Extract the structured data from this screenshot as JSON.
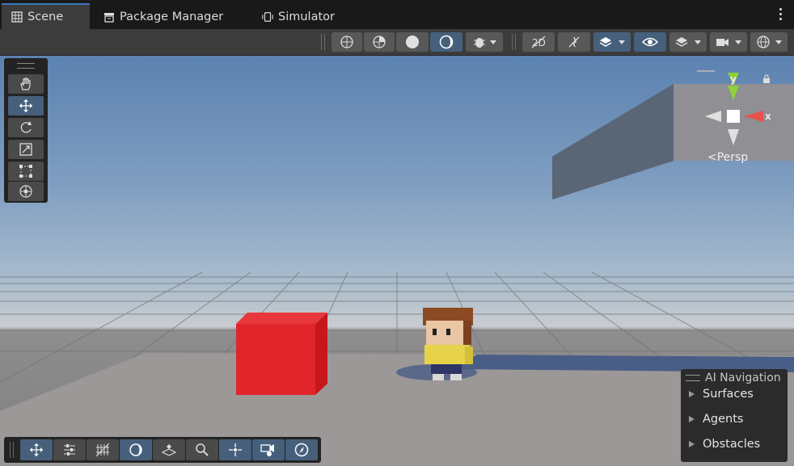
{
  "tabs": [
    {
      "label": "Scene",
      "icon": "scene-grid-icon",
      "active": true
    },
    {
      "label": "Package Manager",
      "icon": "package-icon",
      "active": false
    },
    {
      "label": "Simulator",
      "icon": "device-icon",
      "active": false
    }
  ],
  "scene": {
    "gizmo": {
      "y_label": "y",
      "x_label": "x",
      "projection_label": "<Persp"
    },
    "objects": [
      "red-cube",
      "voxel-character",
      "gray-platform",
      "floating-block"
    ]
  },
  "ai_navigation": {
    "title": "AI Navigation",
    "items": [
      "Surfaces",
      "Agents",
      "Obstacles"
    ]
  },
  "colors": {
    "accent": "#3a79bb",
    "active_button": "#46607c",
    "cube": "#e0252b",
    "sky_top": "#5c82b0",
    "gizmo_y": "#8fd13a",
    "gizmo_x": "#e5534b"
  }
}
